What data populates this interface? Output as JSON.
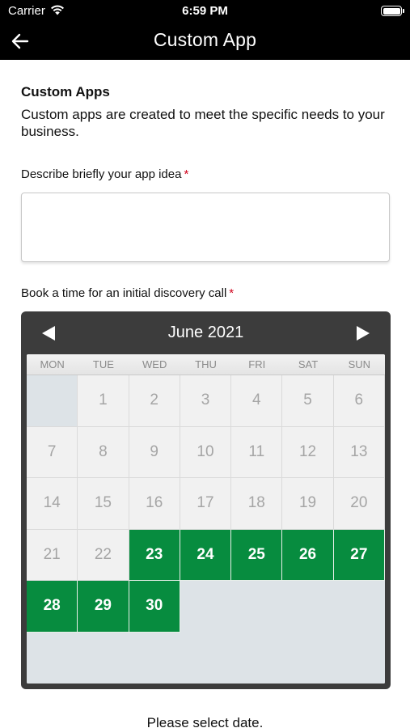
{
  "status_bar": {
    "carrier": "Carrier",
    "time": "6:59 PM"
  },
  "nav": {
    "title": "Custom App",
    "back_icon": "arrow-left-icon"
  },
  "intro": {
    "title": "Custom Apps",
    "description": "Custom apps are created to meet the specific needs to your business."
  },
  "form": {
    "idea_label": "Describe briefly your app idea",
    "idea_value": "",
    "call_label": "Book a time for an initial discovery call",
    "required_mark": "*"
  },
  "calendar": {
    "month_title": "June 2021",
    "weekdays": [
      "MON",
      "TUE",
      "WED",
      "THU",
      "FRI",
      "SAT",
      "SUN"
    ],
    "leading_blanks": 1,
    "days_in_month": 30,
    "available_from": 23,
    "colors": {
      "available": "#078c3f",
      "header": "#3c3c3c"
    }
  },
  "footer": {
    "message": "Please select date."
  }
}
